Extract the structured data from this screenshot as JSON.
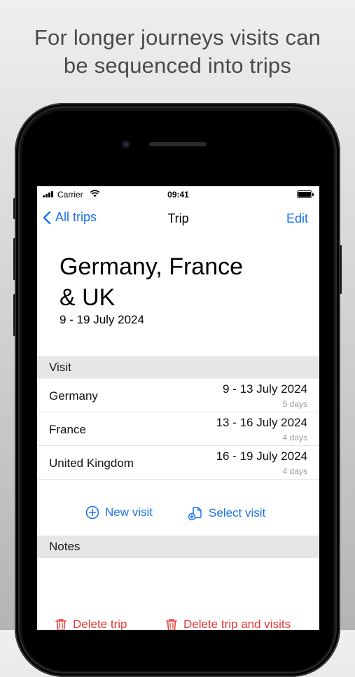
{
  "headline": {
    "line1": "For longer journeys visits can",
    "line2": "be sequenced into trips"
  },
  "status_bar": {
    "carrier": "Carrier",
    "time": "09:41"
  },
  "nav": {
    "back_label": "All trips",
    "title": "Trip",
    "edit_label": "Edit"
  },
  "trip": {
    "title_line1": "Germany, France",
    "title_line2": "& UK",
    "dates": "9 - 19 July 2024"
  },
  "visits": {
    "header": "Visit",
    "rows": [
      {
        "name": "Germany",
        "range": "9 - 13 July 2024",
        "days": "5 days"
      },
      {
        "name": "France",
        "range": "13 - 16 July 2024",
        "days": "4 days"
      },
      {
        "name": "United Kingdom",
        "range": "16 - 19 July 2024",
        "days": "4 days"
      }
    ]
  },
  "actions": {
    "new_visit": "New visit",
    "select_visit": "Select visit"
  },
  "notes": {
    "header": "Notes"
  },
  "delete": {
    "trip": "Delete trip",
    "trip_and_visits": "Delete trip and visits"
  },
  "colors": {
    "accent": "#1a73e8",
    "destructive": "#e53935",
    "section_bg": "#e6e6e6"
  }
}
